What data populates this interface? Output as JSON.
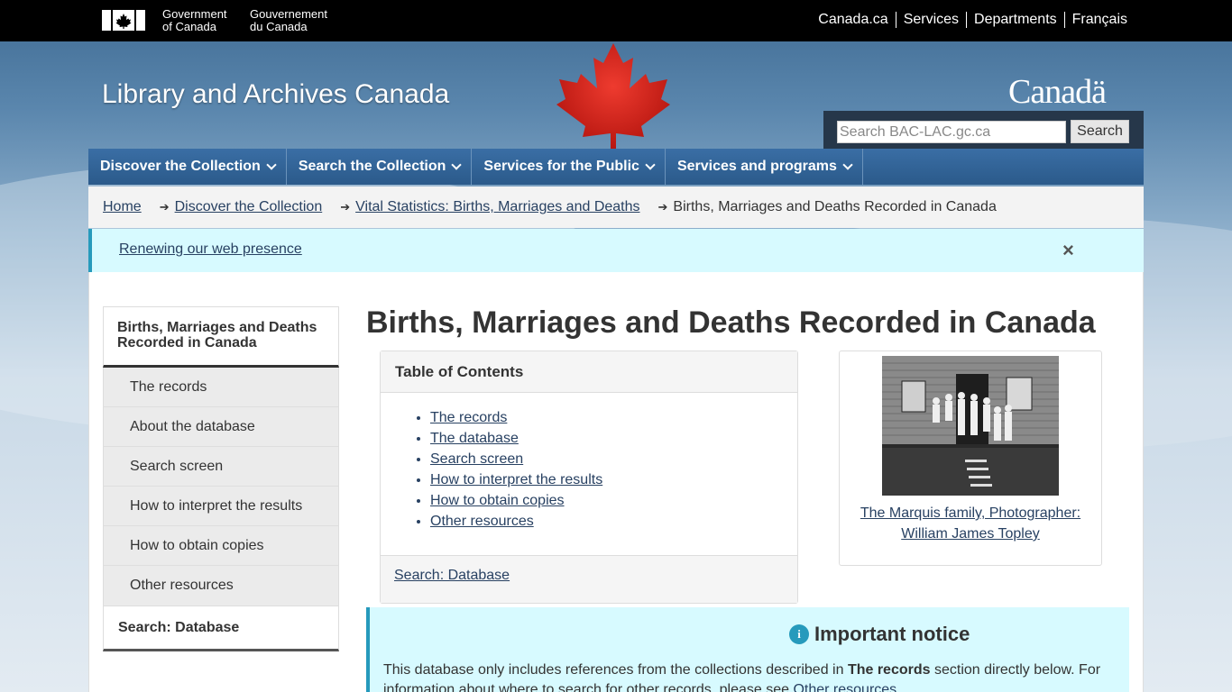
{
  "fip": {
    "gov_en_line1": "Government",
    "gov_en_line2": "of Canada",
    "gov_fr_line1": "Gouvernement",
    "gov_fr_line2": "du Canada",
    "links": [
      "Canada.ca",
      "Services",
      "Departments",
      "Français"
    ]
  },
  "header": {
    "site_title": "Library and Archives Canada",
    "wordmark": "Canadä",
    "search_placeholder": "Search BAC-LAC.gc.ca",
    "search_button": "Search"
  },
  "menu": [
    "Discover the Collection",
    "Search the Collection",
    "Services for the Public",
    "Services and programs"
  ],
  "breadcrumb": {
    "links": [
      "Home",
      "Discover the Collection",
      "Vital Statistics: Births, Marriages and Deaths"
    ],
    "current": "Births, Marriages and Deaths Recorded in Canada"
  },
  "renew_notice": {
    "link": "Renewing our web presence",
    "close_glyph": "×"
  },
  "sidenav": {
    "heading": "Births, Marriages and Deaths Recorded in Canada",
    "items": [
      "The records",
      "About the database",
      "Search screen",
      "How to interpret the results",
      "How to obtain copies",
      "Other resources"
    ],
    "last": "Search: Database"
  },
  "page_title": "Births, Marriages and Deaths Recorded in Canada",
  "toc": {
    "heading": "Table of Contents",
    "items": [
      "The records",
      "The database",
      "Search screen",
      "How to interpret the results",
      "How to obtain copies",
      "Other resources"
    ],
    "footer_link": "Search: Database"
  },
  "figure": {
    "caption_line1": "The Marquis family, Photographer:",
    "caption_line2": "William James Topley"
  },
  "important": {
    "icon_glyph": "i",
    "title": "Important notice",
    "text_before": "This database only includes references from the collections described in ",
    "text_bold": "The records",
    "text_after": " section directly below. For information about where to search for other records, please see ",
    "text_link": "Other resources",
    "text_end": "."
  },
  "colors": {
    "fip_bar": "#000000",
    "menu_blue": "#2b5a8a",
    "link": "#284162",
    "info_border": "#269abc",
    "info_bg": "#d7faff",
    "leaf_red": "#d52b1e"
  }
}
